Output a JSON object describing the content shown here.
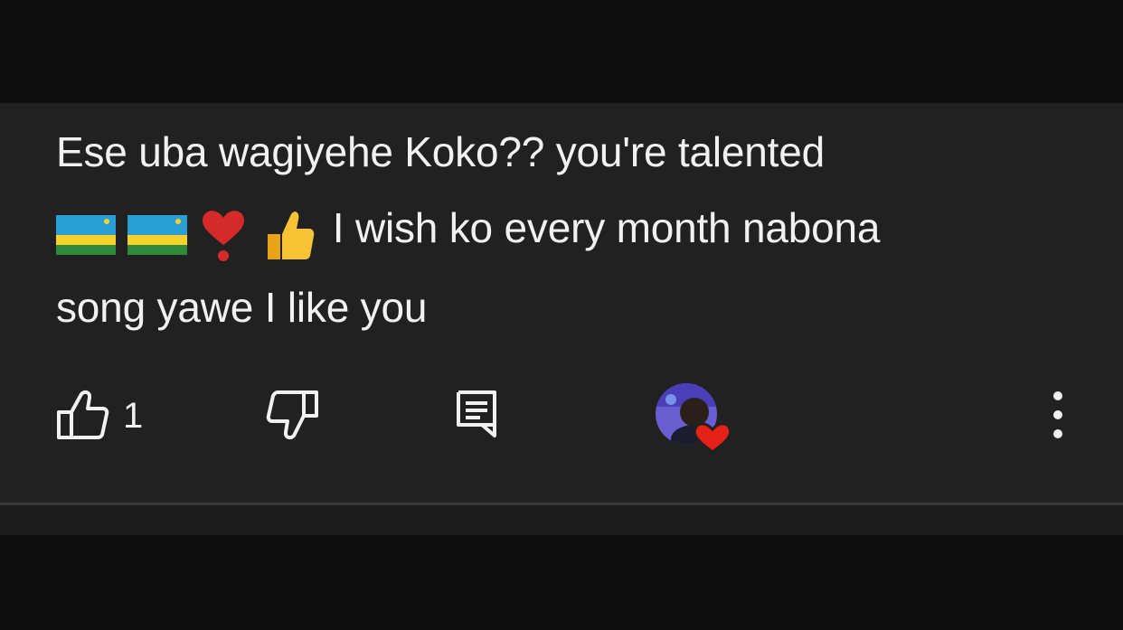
{
  "comment": {
    "line1": "Ese uba wagiyehe Koko?? you're talented",
    "line2_text": "I wish ko every month nabona",
    "line3": "song yawe I like you",
    "emojis": [
      "rwanda-flag",
      "rwanda-flag",
      "red-exclamation-heart",
      "thumbs-up"
    ]
  },
  "actions": {
    "like_count": "1",
    "like_icon": "thumbs-up-outline-icon",
    "dislike_icon": "thumbs-down-outline-icon",
    "reply_icon": "reply-comment-icon",
    "creator_heart": "creator-heart-avatar",
    "more_icon": "vertical-dots-icon"
  },
  "colors": {
    "card_background": "#212121",
    "text": "#f1f1f1",
    "heart_red": "#e62117",
    "page_background": "#0f0f0f"
  }
}
